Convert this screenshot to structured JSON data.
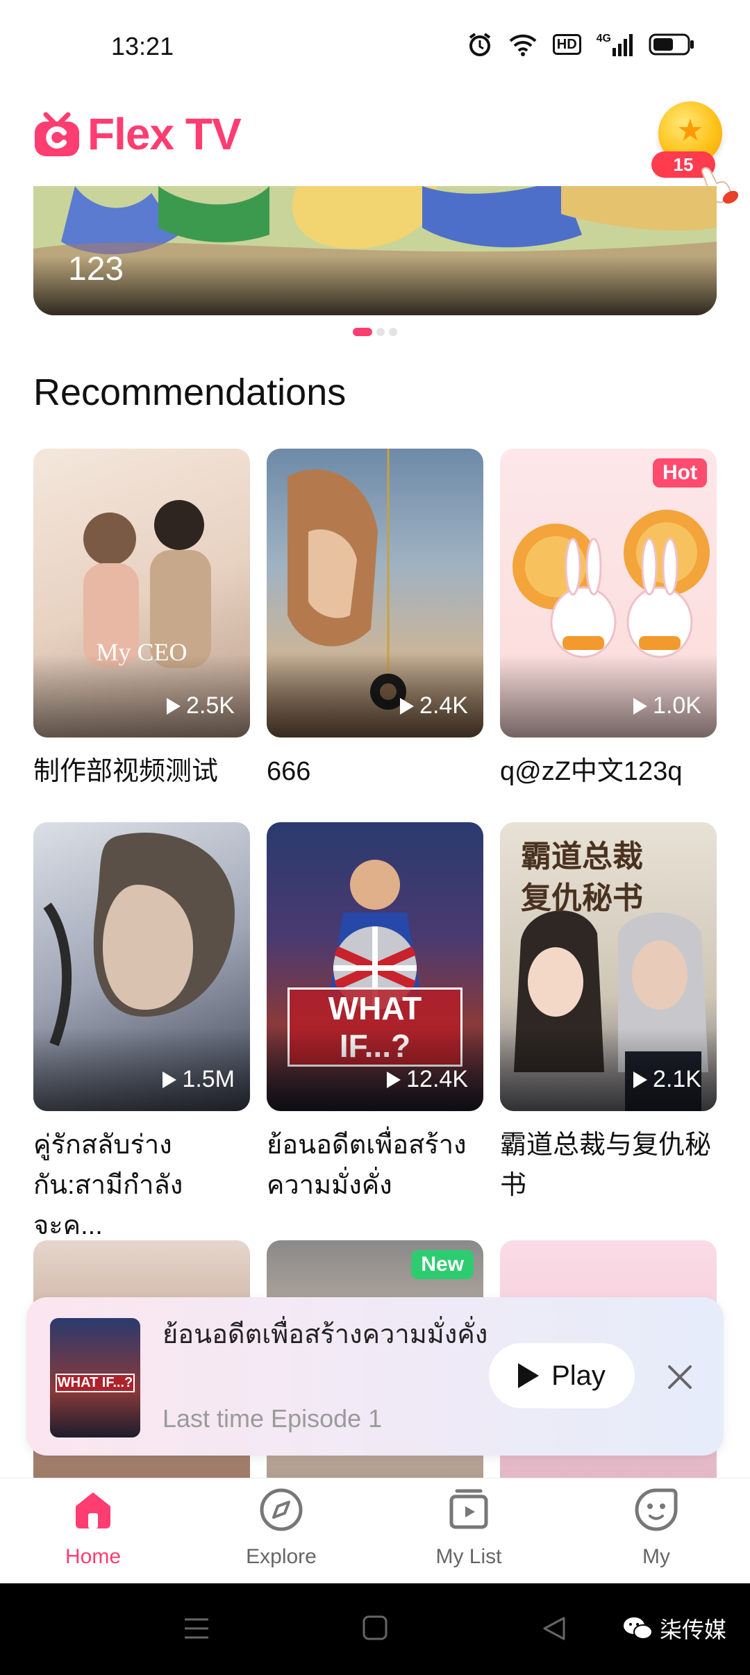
{
  "status_bar": {
    "time": "13:21",
    "hd": "HD",
    "network": "4G"
  },
  "header": {
    "app_name": "Flex TV",
    "coin_count": "15"
  },
  "banner": {
    "caption": "123",
    "page_count": 3,
    "active_index": 0
  },
  "section": {
    "title": "Recommendations"
  },
  "cards": [
    {
      "title": "制作部视频测试",
      "views": "2.5K",
      "badge": "",
      "poster_caption": "My CEO"
    },
    {
      "title": "666",
      "views": "2.4K",
      "badge": ""
    },
    {
      "title": "q@zZ中文123q",
      "views": "1.0K",
      "badge": "Hot"
    },
    {
      "title": "คู่รักสลับร่างกัน:สามีกำลังจะค...",
      "views": "1.5M",
      "badge": ""
    },
    {
      "title": "ย้อนอดีตเพื่อสร้างความมั่งคั่ง",
      "views": "12.4K",
      "badge": "",
      "poster_caption": "WHAT IF...?"
    },
    {
      "title": "霸道总裁与复仇秘书",
      "views": "2.1K",
      "badge": "",
      "poster_caption": "霸道总裁 复仇秘书"
    },
    {
      "badge": ""
    },
    {
      "badge": "New"
    },
    {
      "badge": ""
    }
  ],
  "continue_watching": {
    "title": "ย้อนอดีตเพื่อสร้างความมั่งคั่ง",
    "subtitle": "Last time Episode 1",
    "play_label": "Play",
    "poster_caption": "WHAT IF...?"
  },
  "bottom_nav": [
    {
      "label": "Home",
      "icon": "home-icon",
      "active": true
    },
    {
      "label": "Explore",
      "icon": "compass-icon",
      "active": false
    },
    {
      "label": "My List",
      "icon": "playlist-icon",
      "active": false
    },
    {
      "label": "My",
      "icon": "profile-face-icon",
      "active": false
    }
  ],
  "watermark": {
    "text": "柒传媒"
  },
  "colors": {
    "brand": "#ff3d71",
    "hot": "#ff4b6e",
    "new": "#2ecc71"
  }
}
